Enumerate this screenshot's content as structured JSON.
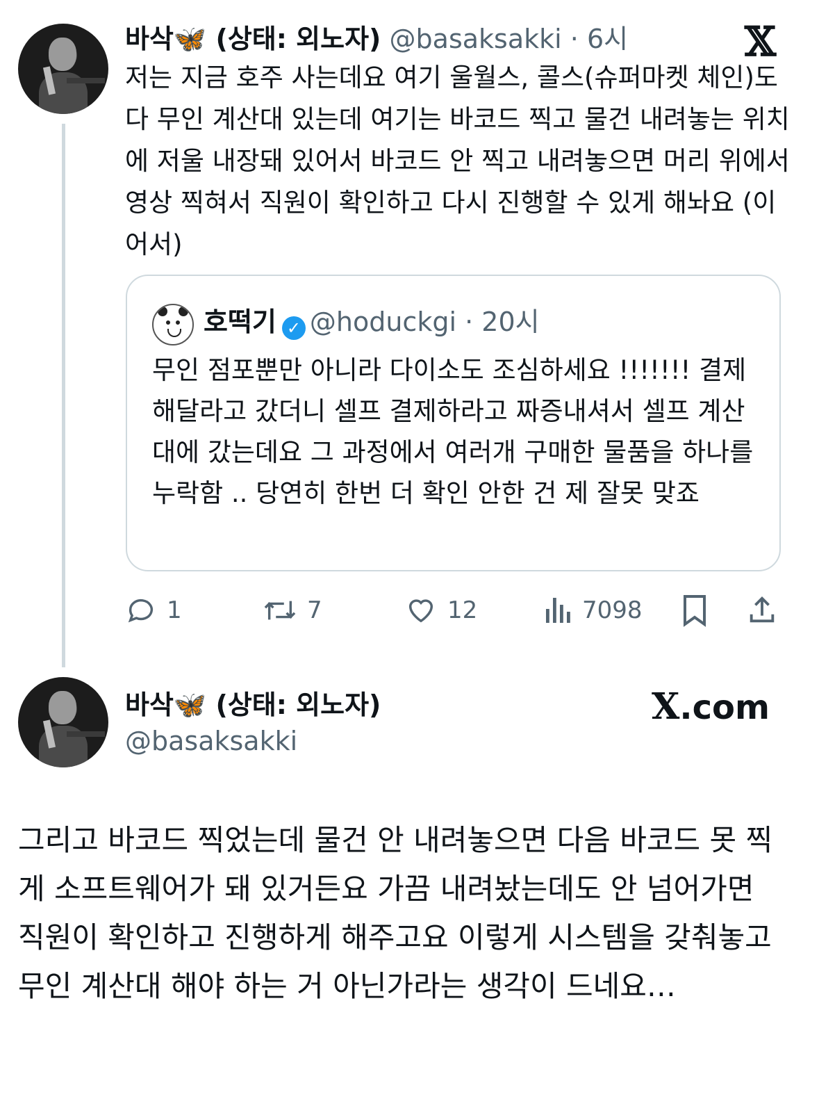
{
  "tweet1": {
    "display_name": "바삭🦋 (상태: 외노자)",
    "handle": "@basaksakki",
    "time": "· 6시",
    "text": "저는 지금 호주 사는데요 여기 울월스, 콜스(슈퍼마켓 체인)도 다 무인 계산대 있는데 여기는 바코드 찍고 물건 내려놓는 위치에 저울 내장돼 있어서 바코드 안 찍고 내려놓으면 머리 위에서 영상 찍혀서 직원이 확인하고 다시 진행할 수 있게 해놔요 (이어서)",
    "platform_icon": "x-logo-icon"
  },
  "quote": {
    "display_name": "호떡기",
    "verified": true,
    "handle": "@hoduckgi",
    "time": "· 20시",
    "text": "무인 점포뿐만 아니라 다이소도 조심하세요 !!!!!!! 결제해달라고 갔더니 셀프 결제하라고 짜증내셔서 셀프 계산대에 갔는데요 그 과정에서 여러개 구매한 물품을 하나를 누락함 .. 당연히 한번 더 확인 안한 건 제 잘못 맞죠"
  },
  "actions": {
    "replies": "1",
    "retweets": "7",
    "likes": "12",
    "views": "7098"
  },
  "tweet2": {
    "display_name": "바삭🦋 (상태: 외노자)",
    "handle": "@basaksakki",
    "brand": ".com",
    "brand_x": "X",
    "text": "그리고 바코드 찍었는데 물건 안 내려놓으면 다음 바코드 못 찍게 소프트웨어가 돼 있거든요 가끔 내려놨는데도 안 넘어가면 직원이 확인하고 진행하게 해주고요 이렇게 시스템을 갖춰놓고 무인 계산대 해야 하는 거 아닌가라는 생각이 드네요…"
  },
  "colors": {
    "accent": "#1d9bf0",
    "muted": "#536471",
    "border": "#cfd9de"
  }
}
